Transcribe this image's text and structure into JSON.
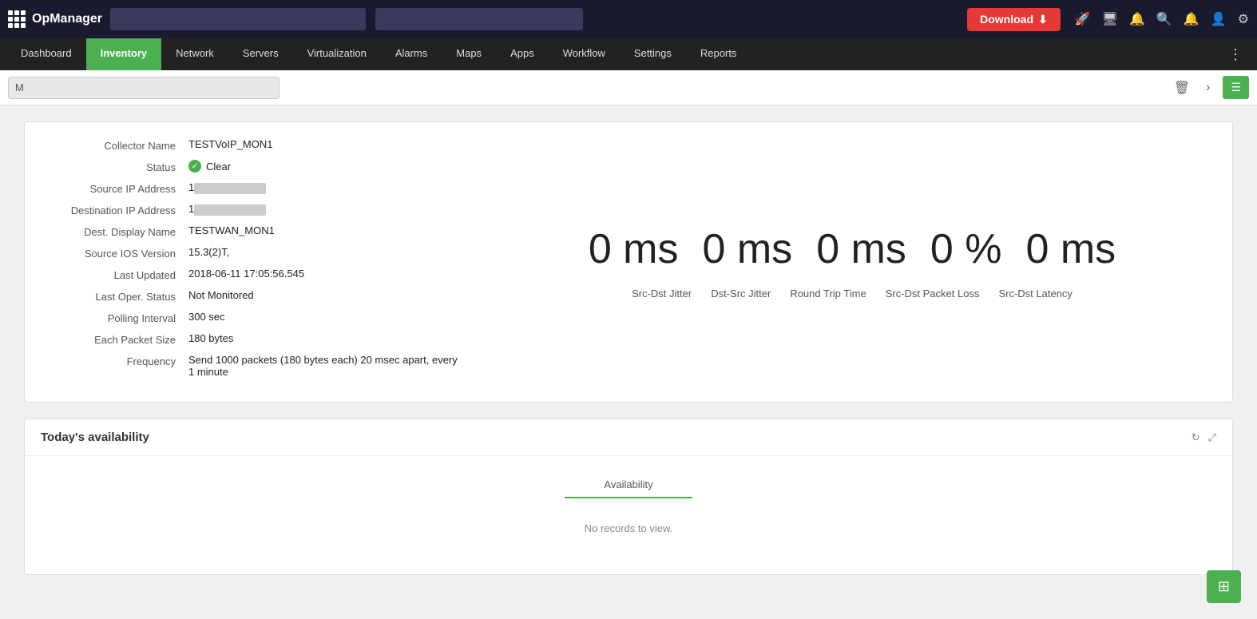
{
  "app": {
    "logo": "OpManager",
    "download_label": "Download"
  },
  "nav": {
    "items": [
      {
        "label": "Dashboard",
        "active": false
      },
      {
        "label": "Inventory",
        "active": true
      },
      {
        "label": "Network",
        "active": false
      },
      {
        "label": "Servers",
        "active": false
      },
      {
        "label": "Virtualization",
        "active": false
      },
      {
        "label": "Alarms",
        "active": false
      },
      {
        "label": "Maps",
        "active": false
      },
      {
        "label": "Apps",
        "active": false
      },
      {
        "label": "Workflow",
        "active": false
      },
      {
        "label": "Settings",
        "active": false
      },
      {
        "label": "Reports",
        "active": false
      }
    ]
  },
  "breadcrumb": {
    "value": "M"
  },
  "details": {
    "collector_name_label": "Collector Name",
    "collector_name_value": "TESTVoIP_MON1",
    "status_label": "Status",
    "status_value": "Clear",
    "source_ip_label": "Source IP Address",
    "source_ip_prefix": "1",
    "dest_ip_label": "Destination IP Address",
    "dest_ip_prefix": "1",
    "dest_display_label": "Dest. Display Name",
    "dest_display_value": "TESTWAN_MON1",
    "source_ios_label": "Source IOS Version",
    "source_ios_value": "15.3(2)T,",
    "last_updated_label": "Last Updated",
    "last_updated_value": "2018-06-11 17:05:56.545",
    "last_oper_label": "Last Oper. Status",
    "last_oper_value": "Not Monitored",
    "polling_label": "Polling Interval",
    "polling_value": "300 sec",
    "packet_size_label": "Each Packet Size",
    "packet_size_value": "180 bytes",
    "frequency_label": "Frequency",
    "frequency_value": "Send 1000 packets (180 bytes each) 20 msec apart, every 1 minute"
  },
  "metrics": {
    "values": [
      {
        "value": "0 ms",
        "label": "Src-Dst Jitter"
      },
      {
        "value": "0 ms",
        "label": "Dst-Src Jitter"
      },
      {
        "value": "0 ms",
        "label": "Round Trip Time"
      },
      {
        "value": "0 %",
        "label": "Src-Dst Packet Loss"
      },
      {
        "value": "0 ms",
        "label": "Src-Dst Latency"
      }
    ]
  },
  "availability": {
    "title": "Today's availability",
    "col_header": "Availability",
    "no_records": "No records to view."
  }
}
